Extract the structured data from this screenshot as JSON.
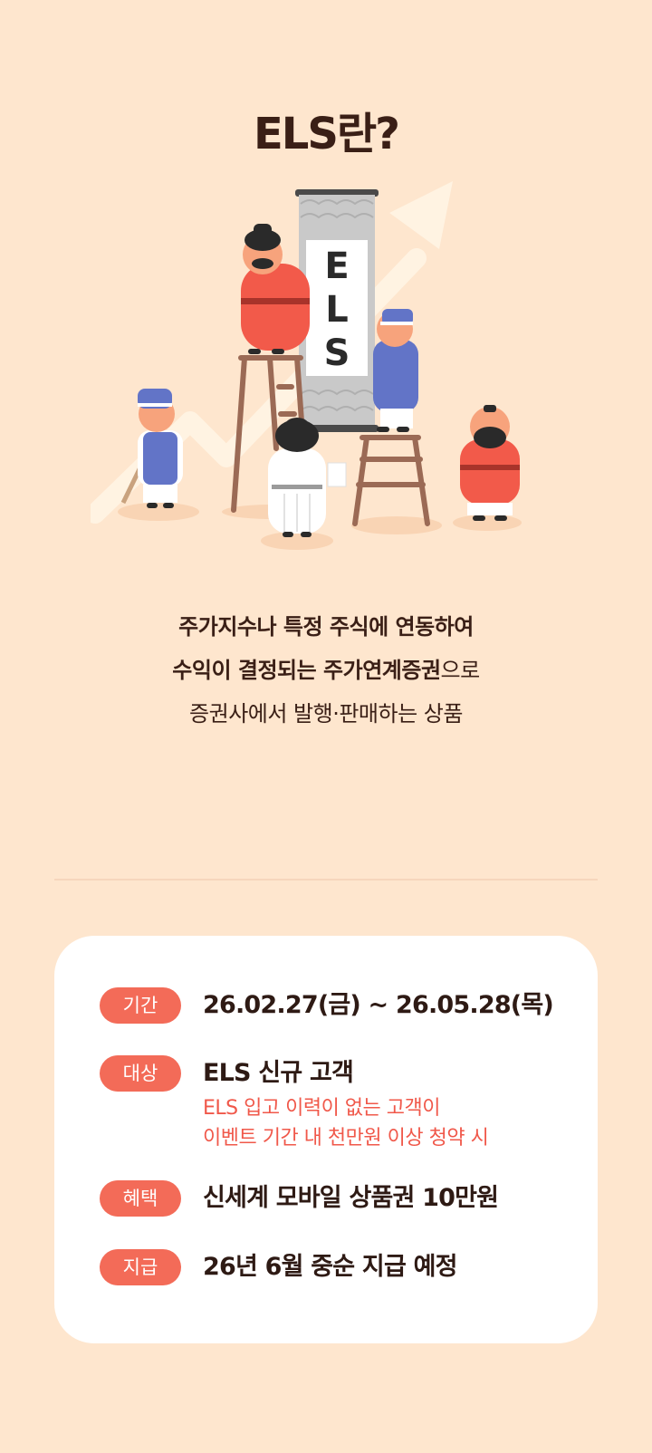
{
  "title": "ELS란?",
  "illustration": {
    "scroll_text": [
      "E",
      "L",
      "S"
    ]
  },
  "description": {
    "line1": "주가지수나 특정 주식에 연동하여",
    "line2_bold": "수익이 결정되는 주가연계증권",
    "line2_regular": "으로",
    "line3": "증권사에서 발행·판매하는 상품"
  },
  "info": {
    "period": {
      "label": "기간",
      "value": "26.02.27(금) ~ 26.05.28(목)"
    },
    "target": {
      "label": "대상",
      "value": "ELS 신규 고객",
      "note_line1": "ELS 입고 이력이 없는 고객이",
      "note_line2": "이벤트 기간 내 천만원 이상 청약 시"
    },
    "benefit": {
      "label": "혜택",
      "value": "신세계 모바일 상품권 10만원"
    },
    "payment": {
      "label": "지급",
      "value": "26년 6월 중순 지급 예정"
    }
  },
  "colors": {
    "background": "#FEE6CE",
    "badge": "#F36B58",
    "note": "#F0584A",
    "text_dark": "#3A1F16"
  }
}
